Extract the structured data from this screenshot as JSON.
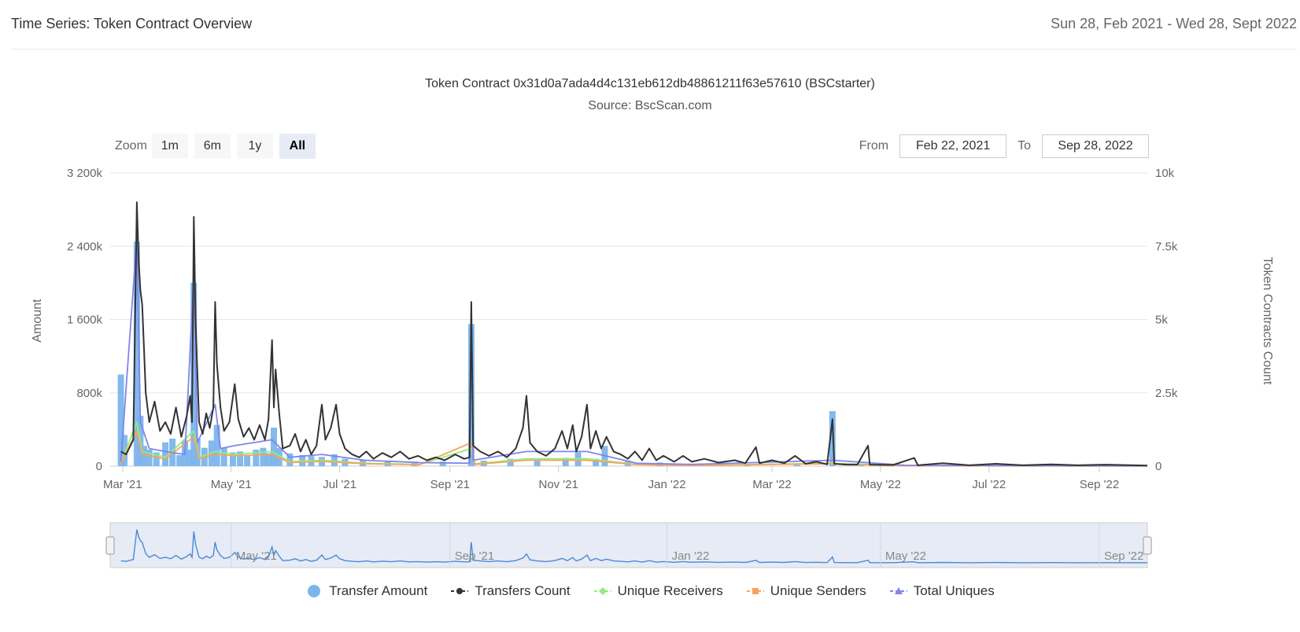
{
  "page": {
    "title": "Time Series: Token Contract Overview",
    "date_range": "Sun 28, Feb 2021 - Wed 28, Sept 2022"
  },
  "chart": {
    "title": "Token Contract 0x31d0a7ada4d4c131eb612db48861211f63e57610 (BSCstarter)",
    "subtitle": "Source: BscScan.com"
  },
  "zoom": {
    "label": "Zoom",
    "buttons": [
      "1m",
      "6m",
      "1y",
      "All"
    ],
    "active": "All"
  },
  "range": {
    "from_label": "From",
    "from_value": "Feb 22, 2021",
    "to_label": "To",
    "to_value": "Sep 28, 2022"
  },
  "colors": {
    "transfer_amount": "#7cb5ec",
    "transfers_count": "#333333",
    "unique_receivers": "#90ed7d",
    "unique_senders": "#f7a35c",
    "total_uniques": "#8085e9",
    "navigator_fill": "#e6ebf5",
    "grid": "#e6e6e6"
  },
  "chart_data": {
    "type": "line",
    "x_start": "2021-02-22",
    "x_end": "2022-09-28",
    "x_ticks": [
      "Mar '21",
      "May '21",
      "Jul '21",
      "Sep '21",
      "Nov '21",
      "Jan '22",
      "Mar '22",
      "May '22",
      "Jul '22",
      "Sep '22"
    ],
    "y_left": {
      "label": "Amount",
      "min": 0,
      "max": 3200000,
      "ticks": [
        "0",
        "800k",
        "1 600k",
        "2 400k",
        "3 200k"
      ]
    },
    "y_right": {
      "label": "Token Contracts Count",
      "min": 0,
      "max": 10000,
      "ticks": [
        "0",
        "2.5k",
        "5k",
        "7.5k",
        "10k"
      ]
    },
    "navigator_ticks": [
      "May '21",
      "Sep '21",
      "Jan '22",
      "May '22",
      "Sep '22"
    ],
    "series": [
      {
        "name": "Transfer Amount",
        "type": "column",
        "axis": "left",
        "points": [
          [
            "2021-02-28",
            1000000
          ],
          [
            "2021-03-02",
            340000
          ],
          [
            "2021-03-09",
            2450000
          ],
          [
            "2021-03-11",
            550000
          ],
          [
            "2021-03-13",
            220000
          ],
          [
            "2021-03-16",
            180000
          ],
          [
            "2021-03-20",
            150000
          ],
          [
            "2021-03-25",
            260000
          ],
          [
            "2021-03-29",
            300000
          ],
          [
            "2021-04-02",
            120000
          ],
          [
            "2021-04-05",
            280000
          ],
          [
            "2021-04-08",
            180000
          ],
          [
            "2021-04-10",
            2000000
          ],
          [
            "2021-04-12",
            300000
          ],
          [
            "2021-04-16",
            200000
          ],
          [
            "2021-04-20",
            280000
          ],
          [
            "2021-04-23",
            450000
          ],
          [
            "2021-04-27",
            200000
          ],
          [
            "2021-05-02",
            150000
          ],
          [
            "2021-05-06",
            160000
          ],
          [
            "2021-05-10",
            120000
          ],
          [
            "2021-05-15",
            180000
          ],
          [
            "2021-05-19",
            200000
          ],
          [
            "2021-05-22",
            140000
          ],
          [
            "2021-05-25",
            420000
          ],
          [
            "2021-05-28",
            200000
          ],
          [
            "2021-06-03",
            140000
          ],
          [
            "2021-06-10",
            120000
          ],
          [
            "2021-06-15",
            110000
          ],
          [
            "2021-06-21",
            100000
          ],
          [
            "2021-06-28",
            130000
          ],
          [
            "2021-07-04",
            80000
          ],
          [
            "2021-07-14",
            70000
          ],
          [
            "2021-07-28",
            60000
          ],
          [
            "2021-08-12",
            50000
          ],
          [
            "2021-08-28",
            50000
          ],
          [
            "2021-09-13",
            1550000
          ],
          [
            "2021-09-20",
            60000
          ],
          [
            "2021-10-05",
            80000
          ],
          [
            "2021-10-20",
            70000
          ],
          [
            "2021-11-05",
            90000
          ],
          [
            "2021-11-12",
            150000
          ],
          [
            "2021-11-22",
            80000
          ],
          [
            "2021-11-27",
            220000
          ],
          [
            "2021-12-10",
            60000
          ],
          [
            "2021-12-28",
            40000
          ],
          [
            "2022-01-20",
            30000
          ],
          [
            "2022-02-15",
            20000
          ],
          [
            "2022-03-15",
            15000
          ],
          [
            "2022-04-04",
            600000
          ],
          [
            "2022-04-20",
            20000
          ],
          [
            "2022-05-15",
            10000
          ],
          [
            "2022-06-15",
            10000
          ],
          [
            "2022-07-15",
            8000
          ],
          [
            "2022-08-15",
            8000
          ],
          [
            "2022-09-15",
            6000
          ]
        ]
      },
      {
        "name": "Transfers Count",
        "type": "line",
        "axis": "right",
        "points": [
          [
            "2021-02-28",
            500
          ],
          [
            "2021-03-03",
            400
          ],
          [
            "2021-03-07",
            900
          ],
          [
            "2021-03-09",
            9000
          ],
          [
            "2021-03-10",
            7000
          ],
          [
            "2021-03-11",
            6000
          ],
          [
            "2021-03-12",
            5500
          ],
          [
            "2021-03-13",
            4000
          ],
          [
            "2021-03-14",
            2500
          ],
          [
            "2021-03-16",
            1500
          ],
          [
            "2021-03-19",
            2200
          ],
          [
            "2021-03-22",
            1200
          ],
          [
            "2021-03-25",
            1500
          ],
          [
            "2021-03-28",
            1100
          ],
          [
            "2021-03-31",
            2000
          ],
          [
            "2021-04-03",
            1000
          ],
          [
            "2021-04-06",
            1700
          ],
          [
            "2021-04-08",
            2400
          ],
          [
            "2021-04-09",
            1500
          ],
          [
            "2021-04-10",
            8500
          ],
          [
            "2021-04-11",
            5000
          ],
          [
            "2021-04-13",
            1500
          ],
          [
            "2021-04-15",
            1100
          ],
          [
            "2021-04-17",
            1800
          ],
          [
            "2021-04-19",
            1300
          ],
          [
            "2021-04-21",
            2000
          ],
          [
            "2021-04-22",
            5600
          ],
          [
            "2021-04-23",
            3500
          ],
          [
            "2021-04-25",
            2000
          ],
          [
            "2021-04-27",
            1200
          ],
          [
            "2021-04-30",
            1500
          ],
          [
            "2021-05-03",
            2800
          ],
          [
            "2021-05-05",
            1600
          ],
          [
            "2021-05-08",
            1000
          ],
          [
            "2021-05-11",
            1300
          ],
          [
            "2021-05-14",
            900
          ],
          [
            "2021-05-17",
            1400
          ],
          [
            "2021-05-20",
            900
          ],
          [
            "2021-05-22",
            1600
          ],
          [
            "2021-05-24",
            4300
          ],
          [
            "2021-05-25",
            2000
          ],
          [
            "2021-05-26",
            3300
          ],
          [
            "2021-05-28",
            1800
          ],
          [
            "2021-05-30",
            600
          ],
          [
            "2021-06-03",
            700
          ],
          [
            "2021-06-06",
            1100
          ],
          [
            "2021-06-09",
            500
          ],
          [
            "2021-06-12",
            900
          ],
          [
            "2021-06-15",
            400
          ],
          [
            "2021-06-18",
            700
          ],
          [
            "2021-06-21",
            2100
          ],
          [
            "2021-06-23",
            900
          ],
          [
            "2021-06-26",
            1300
          ],
          [
            "2021-06-29",
            2100
          ],
          [
            "2021-07-01",
            1100
          ],
          [
            "2021-07-04",
            600
          ],
          [
            "2021-07-08",
            400
          ],
          [
            "2021-07-12",
            300
          ],
          [
            "2021-07-16",
            500
          ],
          [
            "2021-07-20",
            250
          ],
          [
            "2021-07-25",
            450
          ],
          [
            "2021-07-30",
            300
          ],
          [
            "2021-08-04",
            500
          ],
          [
            "2021-08-09",
            250
          ],
          [
            "2021-08-14",
            350
          ],
          [
            "2021-08-19",
            200
          ],
          [
            "2021-08-24",
            300
          ],
          [
            "2021-08-29",
            200
          ],
          [
            "2021-09-04",
            400
          ],
          [
            "2021-09-09",
            250
          ],
          [
            "2021-09-12",
            300
          ],
          [
            "2021-09-13",
            5600
          ],
          [
            "2021-09-14",
            700
          ],
          [
            "2021-09-18",
            500
          ],
          [
            "2021-09-23",
            350
          ],
          [
            "2021-09-28",
            500
          ],
          [
            "2021-10-03",
            300
          ],
          [
            "2021-10-08",
            600
          ],
          [
            "2021-10-12",
            1300
          ],
          [
            "2021-10-14",
            2400
          ],
          [
            "2021-10-16",
            800
          ],
          [
            "2021-10-20",
            500
          ],
          [
            "2021-10-25",
            350
          ],
          [
            "2021-10-30",
            600
          ],
          [
            "2021-11-03",
            1200
          ],
          [
            "2021-11-06",
            600
          ],
          [
            "2021-11-09",
            1400
          ],
          [
            "2021-11-11",
            500
          ],
          [
            "2021-11-14",
            1000
          ],
          [
            "2021-11-17",
            2100
          ],
          [
            "2021-11-19",
            600
          ],
          [
            "2021-11-22",
            1200
          ],
          [
            "2021-11-25",
            600
          ],
          [
            "2021-11-28",
            1000
          ],
          [
            "2021-12-02",
            500
          ],
          [
            "2021-12-06",
            400
          ],
          [
            "2021-12-10",
            250
          ],
          [
            "2021-12-14",
            500
          ],
          [
            "2021-12-18",
            200
          ],
          [
            "2021-12-22",
            600
          ],
          [
            "2021-12-26",
            200
          ],
          [
            "2021-12-30",
            350
          ],
          [
            "2022-01-05",
            150
          ],
          [
            "2022-01-10",
            350
          ],
          [
            "2022-01-15",
            150
          ],
          [
            "2022-01-22",
            250
          ],
          [
            "2022-01-30",
            120
          ],
          [
            "2022-02-08",
            200
          ],
          [
            "2022-02-14",
            100
          ],
          [
            "2022-02-20",
            650
          ],
          [
            "2022-02-22",
            100
          ],
          [
            "2022-03-01",
            200
          ],
          [
            "2022-03-08",
            100
          ],
          [
            "2022-03-14",
            350
          ],
          [
            "2022-03-20",
            80
          ],
          [
            "2022-03-26",
            150
          ],
          [
            "2022-04-01",
            60
          ],
          [
            "2022-04-04",
            1600
          ],
          [
            "2022-04-05",
            80
          ],
          [
            "2022-04-12",
            50
          ],
          [
            "2022-04-18",
            50
          ],
          [
            "2022-04-24",
            700
          ],
          [
            "2022-04-25",
            50
          ],
          [
            "2022-05-08",
            40
          ],
          [
            "2022-05-20",
            280
          ],
          [
            "2022-05-22",
            30
          ],
          [
            "2022-06-05",
            100
          ],
          [
            "2022-06-20",
            30
          ],
          [
            "2022-07-05",
            80
          ],
          [
            "2022-07-20",
            30
          ],
          [
            "2022-08-05",
            60
          ],
          [
            "2022-08-20",
            30
          ],
          [
            "2022-09-05",
            50
          ],
          [
            "2022-09-28",
            20
          ]
        ]
      },
      {
        "name": "Unique Receivers",
        "type": "line",
        "axis": "right",
        "points": [
          [
            "2021-02-28",
            100
          ],
          [
            "2021-03-09",
            1500
          ],
          [
            "2021-03-12",
            500
          ],
          [
            "2021-03-25",
            300
          ],
          [
            "2021-04-10",
            1200
          ],
          [
            "2021-04-13",
            300
          ],
          [
            "2021-04-22",
            500
          ],
          [
            "2021-05-03",
            400
          ],
          [
            "2021-05-24",
            500
          ],
          [
            "2021-06-03",
            150
          ],
          [
            "2021-06-21",
            200
          ],
          [
            "2021-07-15",
            100
          ],
          [
            "2021-08-15",
            60
          ],
          [
            "2021-09-13",
            600
          ],
          [
            "2021-09-15",
            80
          ],
          [
            "2021-10-14",
            250
          ],
          [
            "2021-11-17",
            250
          ],
          [
            "2021-12-15",
            60
          ],
          [
            "2022-01-15",
            30
          ],
          [
            "2022-04-04",
            100
          ],
          [
            "2022-05-15",
            15
          ],
          [
            "2022-09-28",
            5
          ]
        ]
      },
      {
        "name": "Unique Senders",
        "type": "line",
        "axis": "right",
        "points": [
          [
            "2021-02-28",
            80
          ],
          [
            "2021-03-09",
            1200
          ],
          [
            "2021-03-12",
            400
          ],
          [
            "2021-03-25",
            250
          ],
          [
            "2021-04-10",
            1000
          ],
          [
            "2021-04-13",
            250
          ],
          [
            "2021-04-22",
            400
          ],
          [
            "2021-05-03",
            350
          ],
          [
            "2021-05-24",
            400
          ],
          [
            "2021-06-03",
            120
          ],
          [
            "2021-06-21",
            160
          ],
          [
            "2021-07-15",
            80
          ],
          [
            "2021-08-15",
            50
          ],
          [
            "2021-09-13",
            800
          ],
          [
            "2021-09-15",
            60
          ],
          [
            "2021-10-14",
            200
          ],
          [
            "2021-11-17",
            200
          ],
          [
            "2021-12-15",
            50
          ],
          [
            "2022-01-15",
            25
          ],
          [
            "2022-04-04",
            80
          ],
          [
            "2022-05-15",
            12
          ],
          [
            "2022-09-28",
            4
          ]
        ]
      },
      {
        "name": "Total Uniques",
        "type": "line",
        "axis": "right",
        "points": [
          [
            "2021-02-28",
            150
          ],
          [
            "2021-03-09",
            7800
          ],
          [
            "2021-03-11",
            1500
          ],
          [
            "2021-03-16",
            600
          ],
          [
            "2021-03-25",
            500
          ],
          [
            "2021-04-05",
            400
          ],
          [
            "2021-04-10",
            6500
          ],
          [
            "2021-04-12",
            800
          ],
          [
            "2021-04-22",
            2100
          ],
          [
            "2021-04-25",
            600
          ],
          [
            "2021-05-03",
            700
          ],
          [
            "2021-05-24",
            900
          ],
          [
            "2021-06-03",
            300
          ],
          [
            "2021-06-21",
            400
          ],
          [
            "2021-07-15",
            200
          ],
          [
            "2021-08-15",
            120
          ],
          [
            "2021-09-12",
            100
          ],
          [
            "2021-09-13",
            5400
          ],
          [
            "2021-09-14",
            200
          ],
          [
            "2021-10-14",
            500
          ],
          [
            "2021-11-17",
            500
          ],
          [
            "2021-12-15",
            100
          ],
          [
            "2022-01-15",
            60
          ],
          [
            "2022-04-04",
            200
          ],
          [
            "2022-05-15",
            30
          ],
          [
            "2022-09-28",
            10
          ]
        ]
      }
    ],
    "legend_position": "bottom",
    "grid": true
  }
}
